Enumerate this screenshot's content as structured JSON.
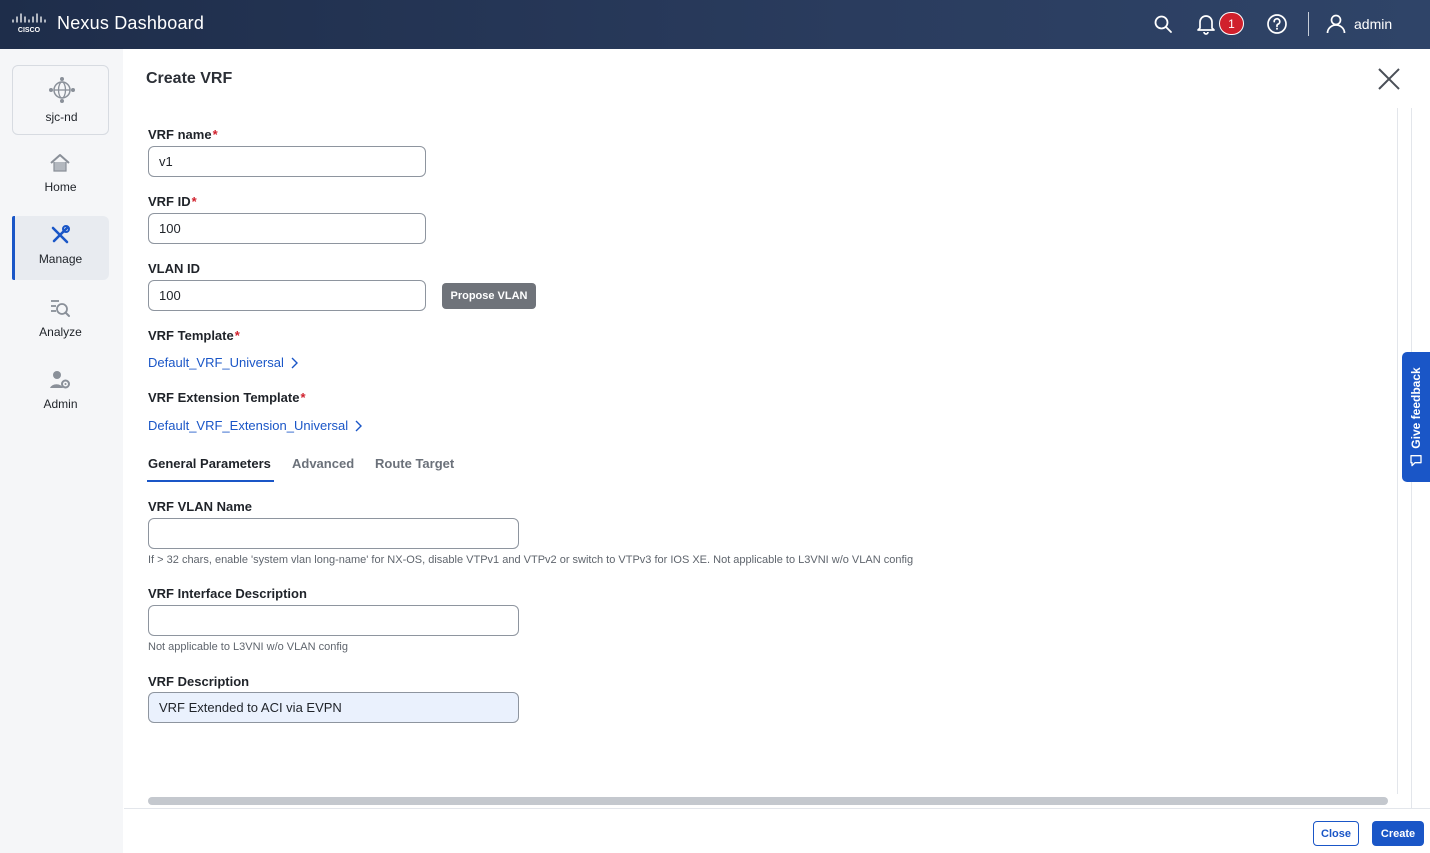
{
  "header": {
    "title": "Nexus Dashboard",
    "notification_count": "1",
    "user": "admin",
    "icons": [
      "cisco-logo",
      "search-icon",
      "bell-icon",
      "help-icon",
      "user-icon"
    ]
  },
  "sidebar": {
    "site": "sjc-nd",
    "items": [
      {
        "label": "Home",
        "icon": "home-icon"
      },
      {
        "label": "Manage",
        "icon": "tools-icon",
        "active": true
      },
      {
        "label": "Analyze",
        "icon": "analyze-icon"
      },
      {
        "label": "Admin",
        "icon": "admin-icon"
      }
    ]
  },
  "dialog": {
    "title": "Create VRF",
    "vrf_name": {
      "label": "VRF name",
      "value": "v1",
      "required": "*"
    },
    "vrf_id": {
      "label": "VRF ID",
      "value": "100",
      "required": "*"
    },
    "vlan_id": {
      "label": "VLAN ID",
      "value": "100"
    },
    "propose_vlan": "Propose VLAN",
    "vrf_template": {
      "label": "VRF Template",
      "required": "*",
      "value": "Default_VRF_Universal"
    },
    "vrf_ext_template": {
      "label": "VRF Extension Template",
      "required": "*",
      "value": "Default_VRF_Extension_Universal"
    },
    "tabs": [
      {
        "label": "General Parameters",
        "active": true
      },
      {
        "label": "Advanced"
      },
      {
        "label": "Route Target"
      }
    ],
    "vrf_vlan_name": {
      "label": "VRF VLAN Name",
      "value": "",
      "help": "If > 32 chars, enable 'system vlan long-name' for NX-OS, disable VTPv1 and VTPv2 or switch to VTPv3 for IOS XE. Not applicable to L3VNI w/o VLAN config"
    },
    "vrf_intf_desc": {
      "label": "VRF Interface Description",
      "value": "",
      "help": "Not applicable to L3VNI w/o VLAN config"
    },
    "vrf_desc": {
      "label": "VRF Description",
      "value": "VRF Extended to ACI via EVPN"
    }
  },
  "feedback": "Give feedback",
  "footer": {
    "close_label": "Close",
    "create_label": "Create"
  },
  "colors": {
    "accent": "#1a56c7",
    "required": "#d0202c",
    "topbar": "#1e2d4a"
  }
}
